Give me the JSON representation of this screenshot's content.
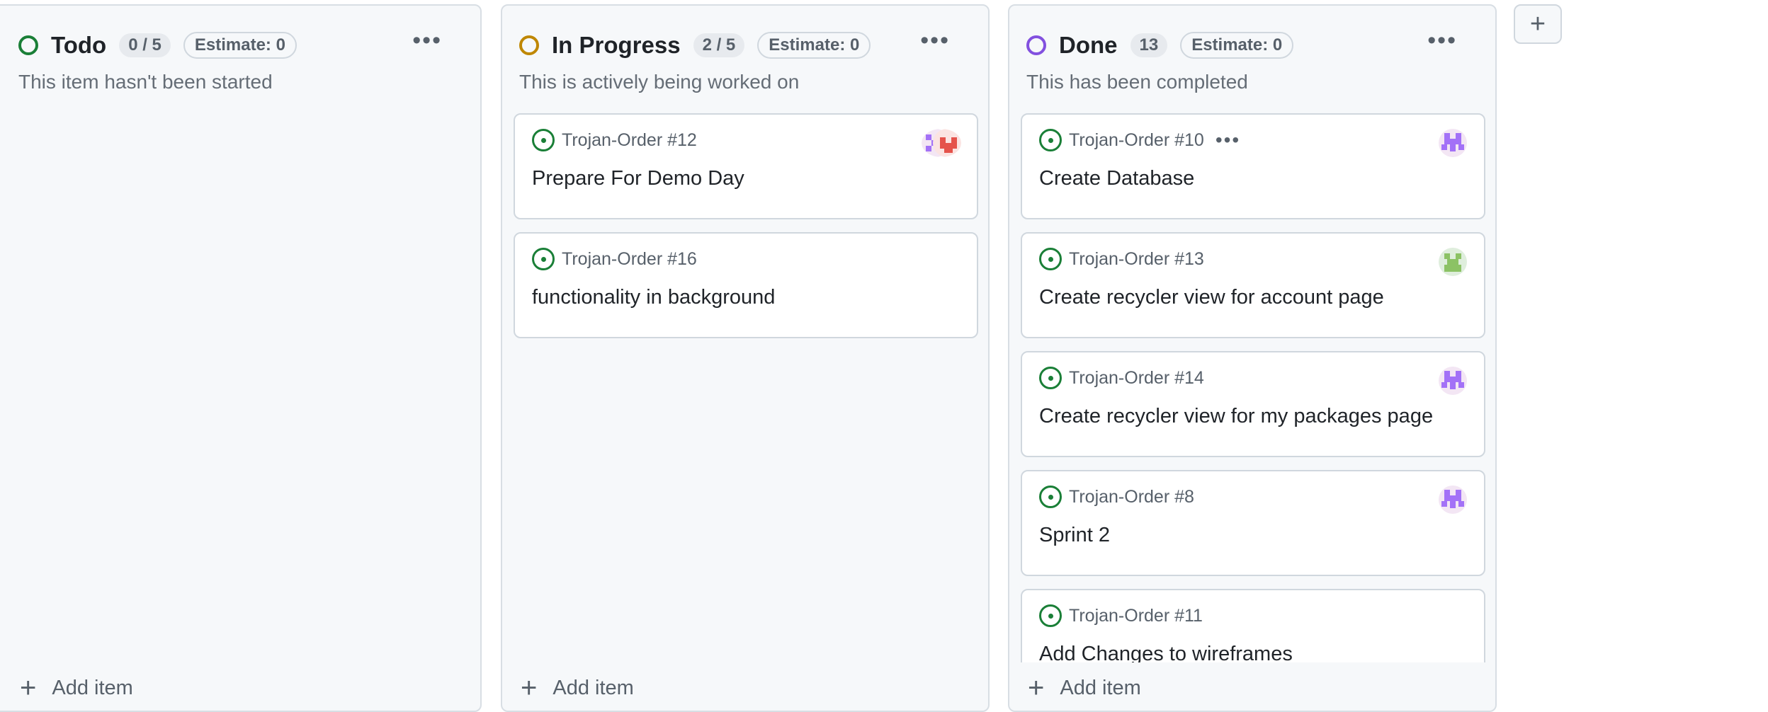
{
  "columns": {
    "todo": {
      "name": "Todo",
      "count": "0 / 5",
      "estimate": "Estimate: 0",
      "description": "This item hasn't been started",
      "status_color": "#1a7f37",
      "add_item": "Add item",
      "cards": []
    },
    "in_progress": {
      "name": "In Progress",
      "count": "2 / 5",
      "estimate": "Estimate: 0",
      "description": "This is actively being worked on",
      "status_color": "#bf8700",
      "add_item": "Add item",
      "cards": [
        {
          "ref": "Trojan-Order #12",
          "title": "Prepare For Demo Day"
        },
        {
          "ref": "Trojan-Order #16",
          "title": "functionality in background"
        }
      ]
    },
    "done": {
      "name": "Done",
      "count": "13",
      "estimate": "Estimate: 0",
      "description": "This has been completed",
      "status_color": "#8250df",
      "add_item": "Add item",
      "cards": [
        {
          "ref": "Trojan-Order #10",
          "title": "Create Database"
        },
        {
          "ref": "Trojan-Order #13",
          "title": "Create recycler view for account page"
        },
        {
          "ref": "Trojan-Order #14",
          "title": "Create recycler view for my packages page"
        },
        {
          "ref": "Trojan-Order #8",
          "title": "Sprint 2"
        },
        {
          "ref": "Trojan-Order #11",
          "title": "Add Changes to wireframes"
        }
      ]
    }
  },
  "icons": {
    "column_menu": "kebab-horizontal-icon",
    "issue_open": "issue-opened-icon",
    "add": "plus-icon",
    "avatar": "identicon-avatar"
  },
  "colors": {
    "issue_open": "#1a7f37",
    "avatar_purple": "#a371f7",
    "avatar_green": "#8cc265",
    "avatar_red": "#e5534b"
  }
}
